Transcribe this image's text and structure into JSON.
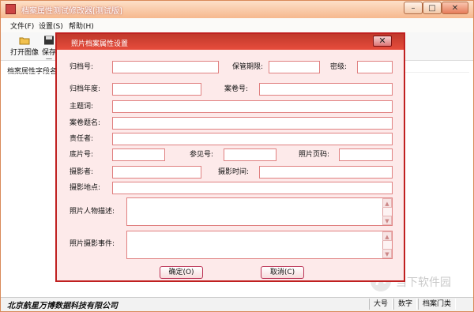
{
  "app": {
    "title": "档案属性测试修改器[测试版]",
    "menu": [
      "文件(F)",
      "设置(S)",
      "帮助(H)"
    ],
    "toolbar": [
      "打开图像",
      "保存图"
    ],
    "field_header": "档案属性字段名",
    "status": {
      "company": "北京航星万博数据科技有限公司",
      "cells": [
        "大号",
        "数字",
        "档案门类"
      ]
    }
  },
  "dialog": {
    "title": "照片档案属性设置",
    "labels": {
      "archive_no": "归档号:",
      "retention": "保管期限:",
      "secret": "密级:",
      "year": "归档年度:",
      "volume_no": "案卷号:",
      "subject": "主题词:",
      "volume_title": "案卷题名:",
      "responsible": "责任者:",
      "film_no": "底片号:",
      "ref_no": "参见号:",
      "photo_page": "照片页码:",
      "photographer": "摄影者:",
      "shoot_time": "摄影时间:",
      "location": "摄影地点:",
      "people_desc": "照片人物描述:",
      "event": "照片摄影事件:"
    },
    "buttons": {
      "ok": "确定(O)",
      "cancel": "取消(C)"
    }
  },
  "watermark": {
    "text": "当下软件园"
  }
}
